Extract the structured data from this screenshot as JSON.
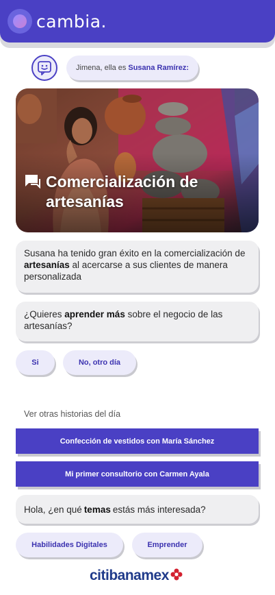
{
  "header": {
    "brand": "cambia.",
    "colors": {
      "primary": "#4a40c4",
      "bubble": "#ecebfa",
      "card": "#efeff1"
    }
  },
  "intro": {
    "icon": "chat-bot-icon",
    "prefix": "Jimena, ella es",
    "name": "Susana Ramírez:"
  },
  "hero": {
    "title": "Comercialización de artesanías",
    "icon": "chat-icon"
  },
  "messages": {
    "story": {
      "part1": "Susana ha tenido gran éxito en la comercialización de ",
      "bold": "artesanías",
      "part2": " al acercarse a sus clientes de manera personalizada"
    },
    "question": {
      "part1": "¿Quieres ",
      "bold": "aprender más",
      "part2": " sobre el negocio de las artesanías?"
    },
    "topics": {
      "part1": "Hola, ¿en qué ",
      "bold": "temas",
      "part2": " estás más interesada?"
    }
  },
  "answers": {
    "yes": "Si",
    "no": "No, otro día"
  },
  "other_stories": {
    "label": "Ver otras historias del día",
    "items": [
      "Confección de vestidos con María Sánchez",
      "Mi primer consultorio con Carmen Ayala"
    ]
  },
  "topic_options": [
    "Habilidades Digitales",
    "Emprender"
  ],
  "footer": {
    "brand": "citibanamex"
  }
}
